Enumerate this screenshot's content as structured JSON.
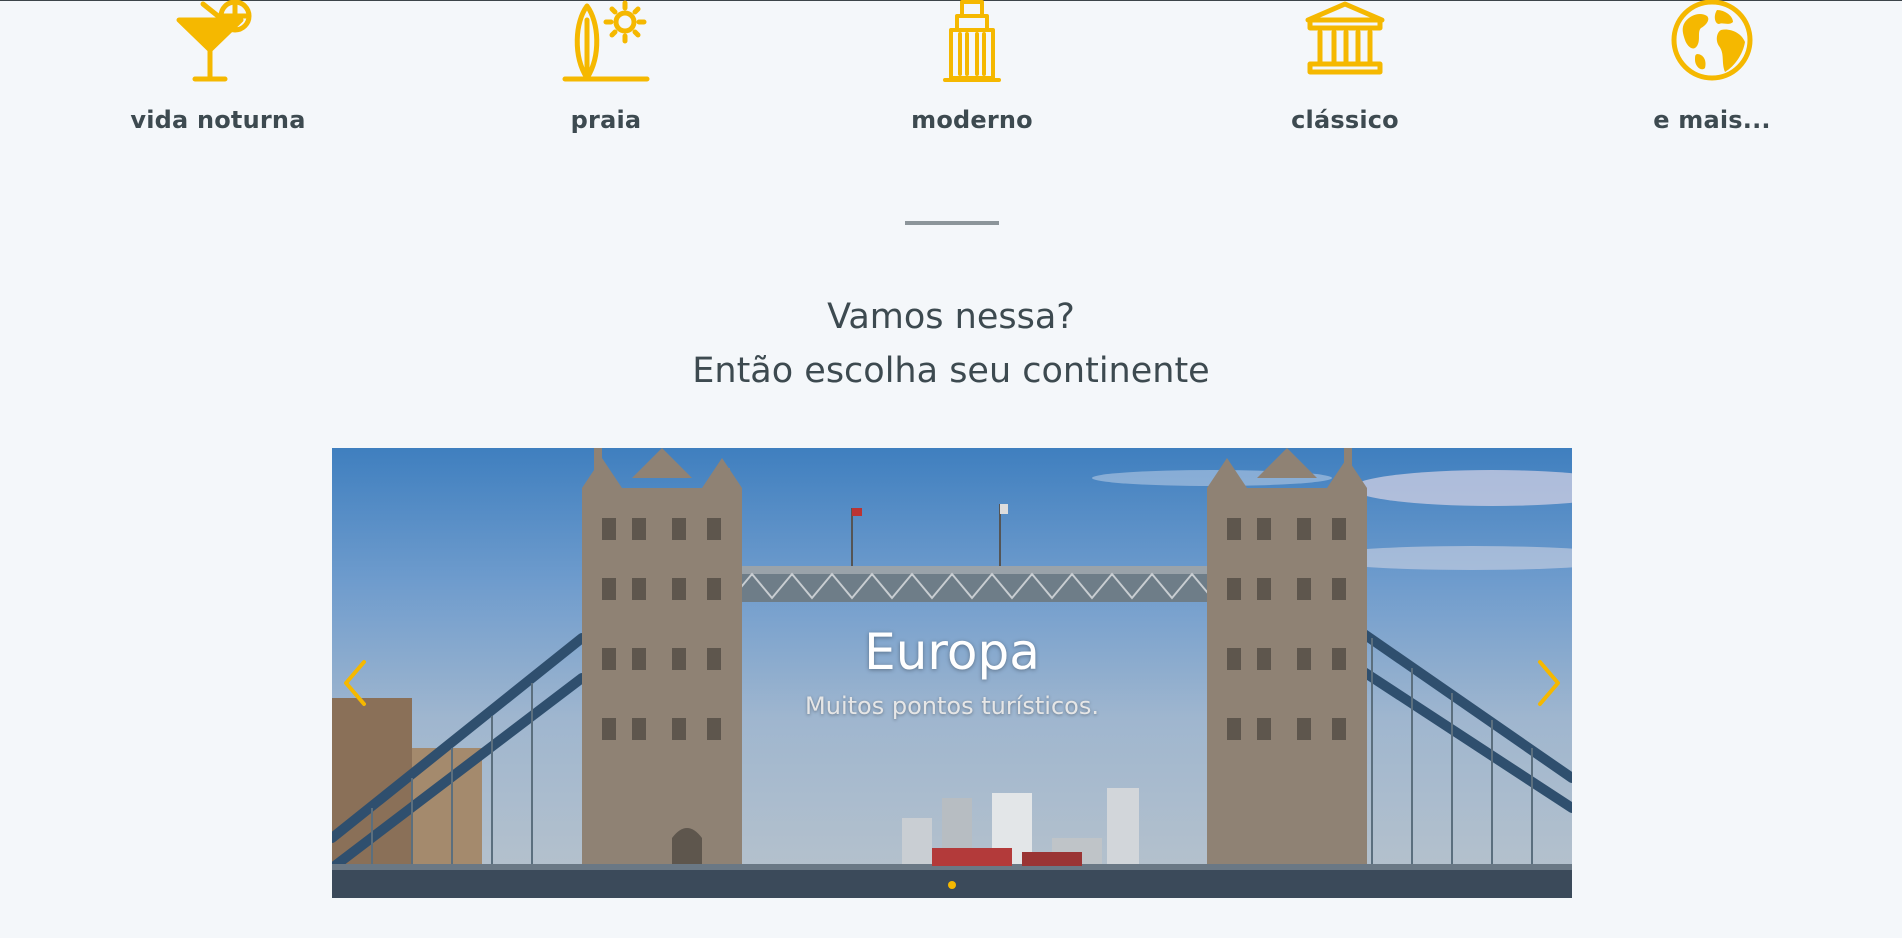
{
  "colors": {
    "accent": "#f5b800",
    "text": "#3d4a50",
    "background": "#f4f7fa"
  },
  "categories": [
    {
      "icon": "cocktail-icon",
      "label": "vida noturna"
    },
    {
      "icon": "surfboard-sun-icon",
      "label": "praia"
    },
    {
      "icon": "skyscraper-icon",
      "label": "moderno"
    },
    {
      "icon": "temple-icon",
      "label": "clássico"
    },
    {
      "icon": "globe-icon",
      "label": "e mais..."
    }
  ],
  "section": {
    "line1": "Vamos nessa?",
    "line2": "Então escolha seu continente"
  },
  "carousel": {
    "slide_title": "Europa",
    "slide_subtitle": "Muitos pontos turísticos.",
    "image_subject": "tower-bridge-photo",
    "active_index": 0,
    "slide_count": 1,
    "prev_icon": "chevron-left-icon",
    "next_icon": "chevron-right-icon"
  }
}
